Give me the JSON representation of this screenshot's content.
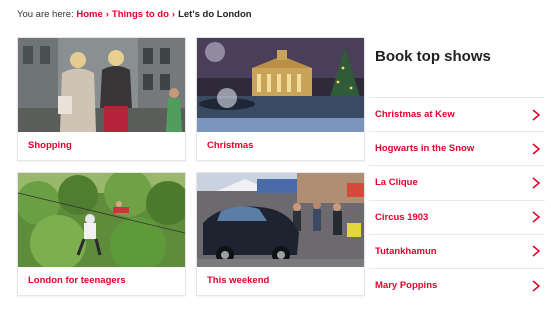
{
  "breadcrumb": {
    "prefix": "You are here:",
    "items": [
      "Home",
      "Things to do"
    ],
    "current": "Let's do London"
  },
  "cards": [
    {
      "title": "Shopping",
      "image_icon": "shopping-photo"
    },
    {
      "title": "Christmas",
      "image_icon": "christmas-photo"
    },
    {
      "title": "London for teenagers",
      "image_icon": "zipwire-photo"
    },
    {
      "title": "This weekend",
      "image_icon": "street-event-photo"
    }
  ],
  "shows": {
    "title": "Book top shows",
    "items": [
      "Christmas at Kew",
      "Hogwarts in the Snow",
      "La Clique",
      "Circus 1903",
      "Tutankhamun",
      "Mary Poppins"
    ]
  },
  "colors": {
    "accent": "#e4002b",
    "text": "#222222",
    "divider": "#e8e8e8"
  }
}
